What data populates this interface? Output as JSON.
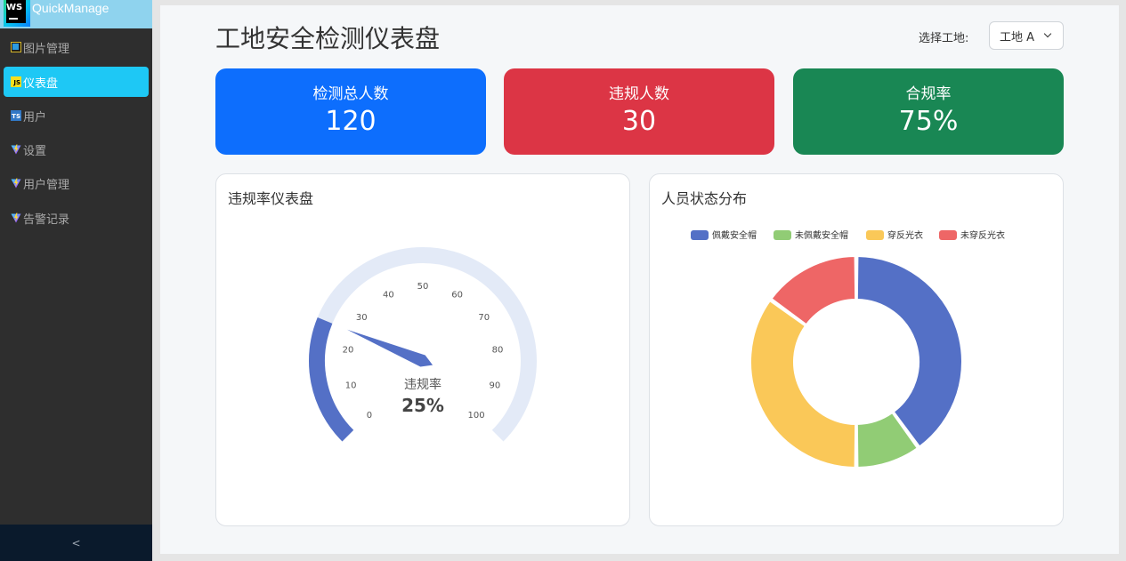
{
  "app": {
    "name": "QuickManage",
    "logo_text": "WS",
    "collapse_label": "<"
  },
  "sidebar": {
    "items": [
      {
        "label": "图片管理",
        "icon": "image-icon",
        "active": false
      },
      {
        "label": "仪表盘",
        "icon": "js-icon",
        "active": true
      },
      {
        "label": "用户",
        "icon": "ts-icon",
        "active": false
      },
      {
        "label": "设置",
        "icon": "vite-icon",
        "active": false
      },
      {
        "label": "用户管理",
        "icon": "vite-icon",
        "active": false
      },
      {
        "label": "告警记录",
        "icon": "vite-icon",
        "active": false
      }
    ]
  },
  "header": {
    "title": "工地安全检测仪表盘",
    "site_label": "选择工地:",
    "site_selected": "工地 A"
  },
  "stats": [
    {
      "label": "检测总人数",
      "value": "120",
      "color": "#0d6efd"
    },
    {
      "label": "违规人数",
      "value": "30",
      "color": "#dc3545"
    },
    {
      "label": "合规率",
      "value": "75%",
      "color": "#198754"
    }
  ],
  "gauge_card": {
    "title": "违规率仪表盘",
    "name": "违规率",
    "value": 25,
    "value_text": "25%",
    "min": 0,
    "max": 100,
    "ticks": [
      "0",
      "10",
      "20",
      "30",
      "40",
      "50",
      "60",
      "70",
      "80",
      "90",
      "100"
    ],
    "colors": {
      "progress": "#5470c6",
      "track": "#e3eaf7"
    }
  },
  "donut_card": {
    "title": "人员状态分布"
  },
  "chart_data": {
    "type": "pie",
    "title": "人员状态分布",
    "categories": [
      "佩戴安全帽",
      "未佩戴安全帽",
      "穿反光衣",
      "未穿反光衣"
    ],
    "values": [
      40,
      10,
      35,
      15
    ],
    "colors": [
      "#5470c6",
      "#91cc75",
      "#fac858",
      "#ee6666"
    ],
    "legend": "top-center"
  }
}
